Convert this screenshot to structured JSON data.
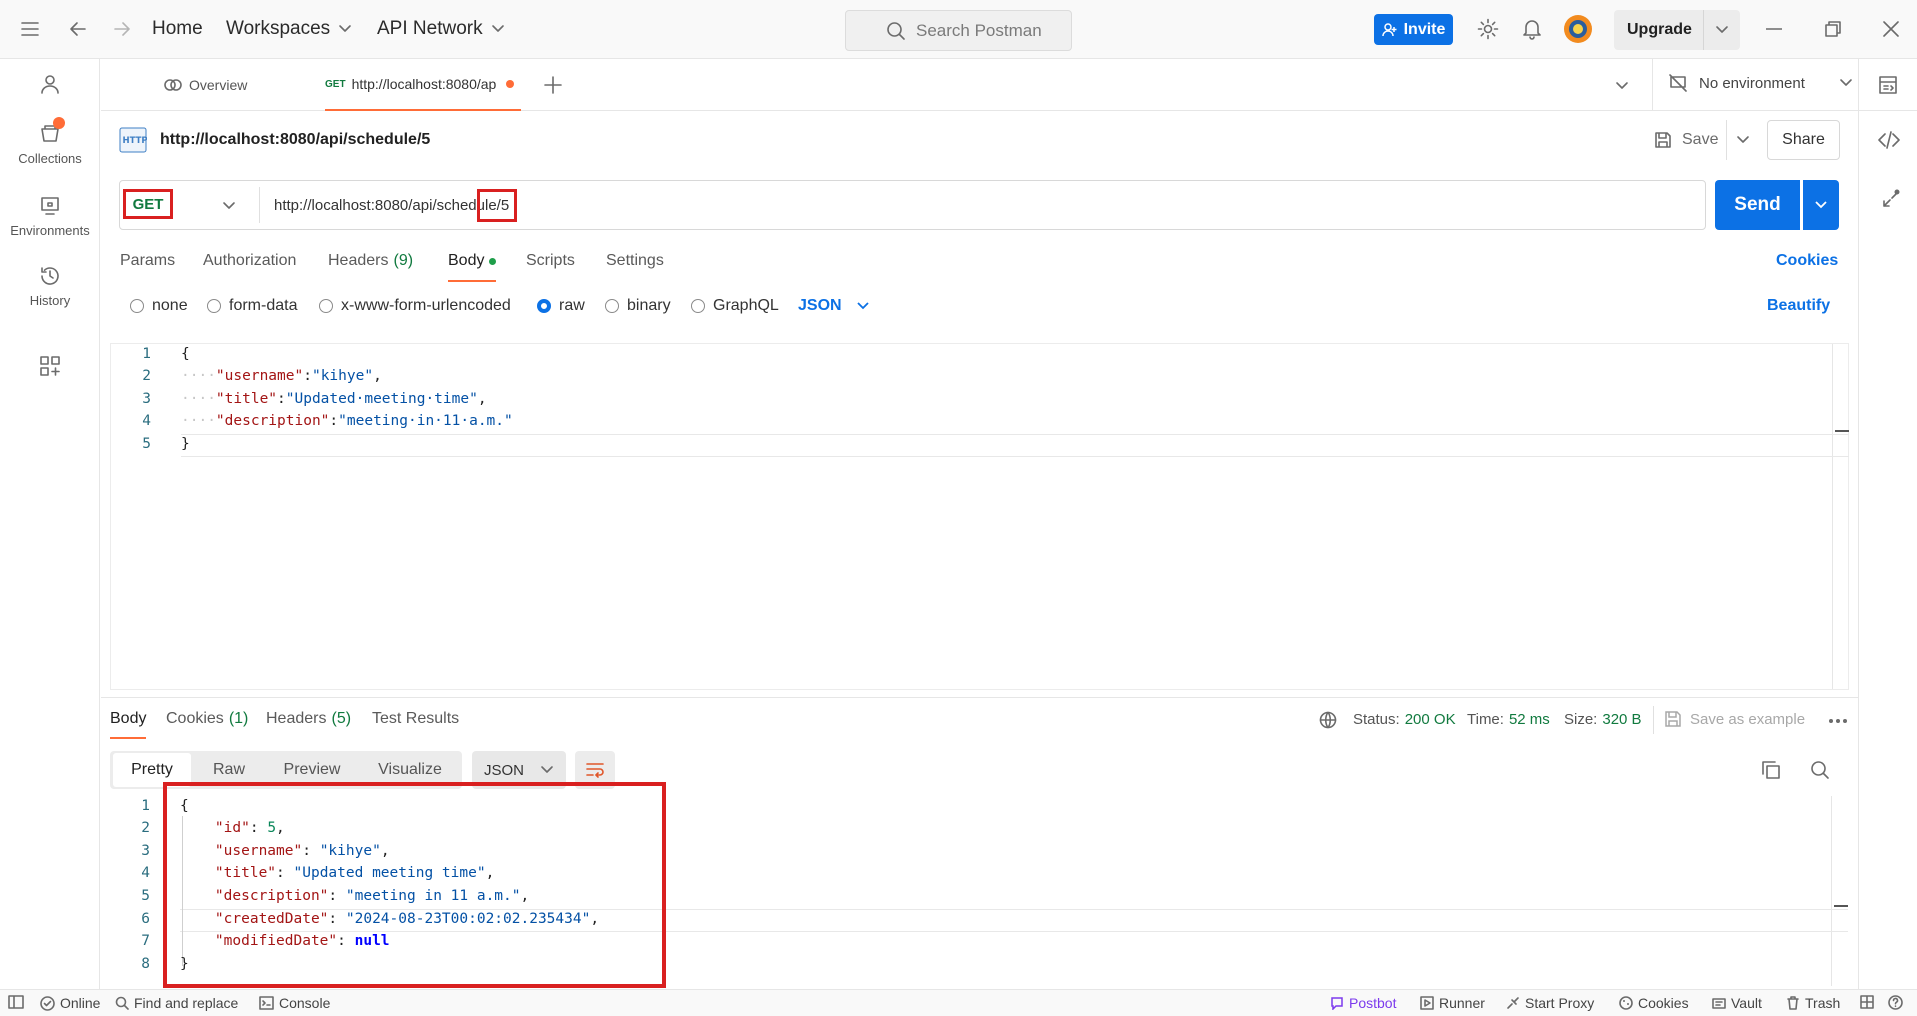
{
  "topbar": {
    "home": "Home",
    "workspaces": "Workspaces",
    "api_network": "API Network",
    "search_placeholder": "Search Postman",
    "invite": "Invite",
    "upgrade": "Upgrade"
  },
  "sidebar": {
    "items": [
      {
        "label": "Collections",
        "icon": "collections-icon"
      },
      {
        "label": "Environments",
        "icon": "environments-icon"
      },
      {
        "label": "History",
        "icon": "history-icon"
      }
    ]
  },
  "tabs": {
    "overview": "Overview",
    "active_method": "GET",
    "active_url": "http://localhost:8080/ap",
    "environment": "No environment"
  },
  "request": {
    "name": "http://localhost:8080/api/schedule/5",
    "save": "Save",
    "share": "Share",
    "method": "GET",
    "url_prefix": "http://localhost:8080/api/schedu",
    "url_highlight": "le/5",
    "send": "Send",
    "subtabs": [
      "Params",
      "Authorization",
      "Headers",
      "Body",
      "Scripts",
      "Settings"
    ],
    "headers_count": "(9)",
    "cookies": "Cookies",
    "body_types": [
      "none",
      "form-data",
      "x-www-form-urlencoded",
      "raw",
      "binary",
      "GraphQL"
    ],
    "body_lang": "JSON",
    "beautify": "Beautify",
    "body_lines": [
      "{",
      "    \"username\":\"kihye\",",
      "    \"title\":\"Updated meeting time\",",
      "    \"description\":\"meeting in 11 a.m.\"",
      "}"
    ]
  },
  "response": {
    "tabs": [
      "Body",
      "Cookies",
      "Headers",
      "Test Results"
    ],
    "cookies_count": "(1)",
    "headers_count": "(5)",
    "status_label": "Status:",
    "status": "200 OK",
    "time_label": "Time:",
    "time": "52 ms",
    "size_label": "Size:",
    "size": "320 B",
    "save_example": "Save as example",
    "formats": [
      "Pretty",
      "Raw",
      "Preview",
      "Visualize"
    ],
    "lang": "JSON",
    "body": {
      "id": "5",
      "username": "\"kihye\"",
      "title": "\"Updated meeting time\"",
      "description": "\"meeting in 11 a.m.\"",
      "createdDate": "\"2024-08-23T00:02:02.235434\"",
      "modifiedDate": "null"
    }
  },
  "footer": {
    "online": "Online",
    "find_replace": "Find and replace",
    "console": "Console",
    "postbot": "Postbot",
    "runner": "Runner",
    "start_proxy": "Start Proxy",
    "cookies": "Cookies",
    "vault": "Vault",
    "trash": "Trash"
  },
  "colors": {
    "accent": "#0c71e5",
    "active_tab": "#ff6c37",
    "method_get": "#117a3f",
    "highlight_box": "#d92020"
  }
}
